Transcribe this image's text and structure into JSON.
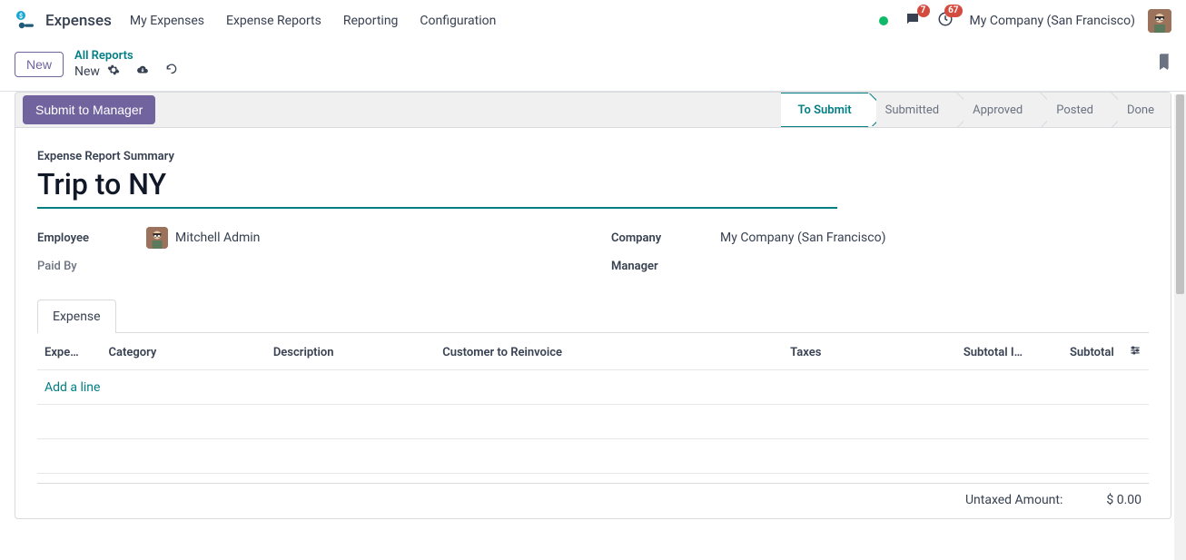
{
  "nav": {
    "app_title": "Expenses",
    "items": [
      "My Expenses",
      "Expense Reports",
      "Reporting",
      "Configuration"
    ],
    "messages_badge": "7",
    "activities_badge": "67",
    "company": "My Company (San Francisco)"
  },
  "control": {
    "new_button": "New",
    "breadcrumb_parent": "All Reports",
    "breadcrumb_current": "New"
  },
  "actions": {
    "submit": "Submit to Manager"
  },
  "status_steps": [
    "To Submit",
    "Submitted",
    "Approved",
    "Posted",
    "Done"
  ],
  "active_status_index": 0,
  "form": {
    "summary_label": "Expense Report Summary",
    "title": "Trip to NY",
    "fields": {
      "employee_label": "Employee",
      "employee_value": "Mitchell Admin",
      "company_label": "Company",
      "company_value": "My Company (San Francisco)",
      "paidby_label": "Paid By",
      "paidby_value": "",
      "manager_label": "Manager",
      "manager_value": ""
    }
  },
  "tabs": {
    "expense": "Expense"
  },
  "table": {
    "headers": {
      "date": "Expe…",
      "category": "Category",
      "description": "Description",
      "customer": "Customer to Reinvoice",
      "taxes": "Taxes",
      "subtotal_in": "Subtotal I…",
      "subtotal": "Subtotal"
    },
    "add_line": "Add a line"
  },
  "totals": {
    "untaxed_label": "Untaxed Amount:",
    "untaxed_value": "$ 0.00"
  }
}
